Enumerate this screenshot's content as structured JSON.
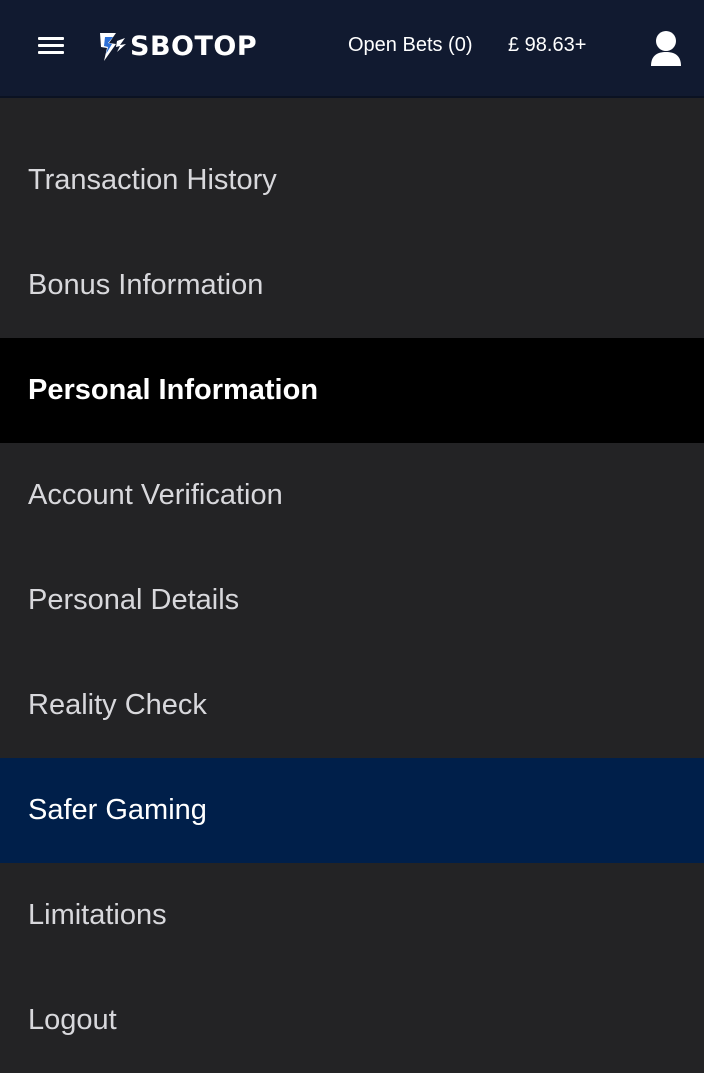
{
  "header": {
    "brand": "SBOTOP",
    "open_bets_label": "Open Bets (0)",
    "balance": "£ 98.63+",
    "icons": {
      "menu": "hamburger-menu-icon",
      "logo": "sbotop-logo-icon",
      "user": "user-profile-icon"
    }
  },
  "menu": {
    "items": [
      {
        "label": "Transaction History",
        "state": "normal"
      },
      {
        "label": "Bonus Information",
        "state": "normal"
      },
      {
        "label": "Personal Information",
        "state": "active"
      },
      {
        "label": "Account Verification",
        "state": "normal"
      },
      {
        "label": "Personal Details",
        "state": "normal"
      },
      {
        "label": "Reality Check",
        "state": "normal"
      },
      {
        "label": "Safer Gaming",
        "state": "highlight"
      },
      {
        "label": "Limitations",
        "state": "normal"
      },
      {
        "label": "Logout",
        "state": "normal"
      }
    ]
  },
  "colors": {
    "header_bg": "#111a30",
    "page_bg": "#232325",
    "active_bg": "#000000",
    "highlight_bg": "#001f4a",
    "text": "#d8d8dc"
  }
}
